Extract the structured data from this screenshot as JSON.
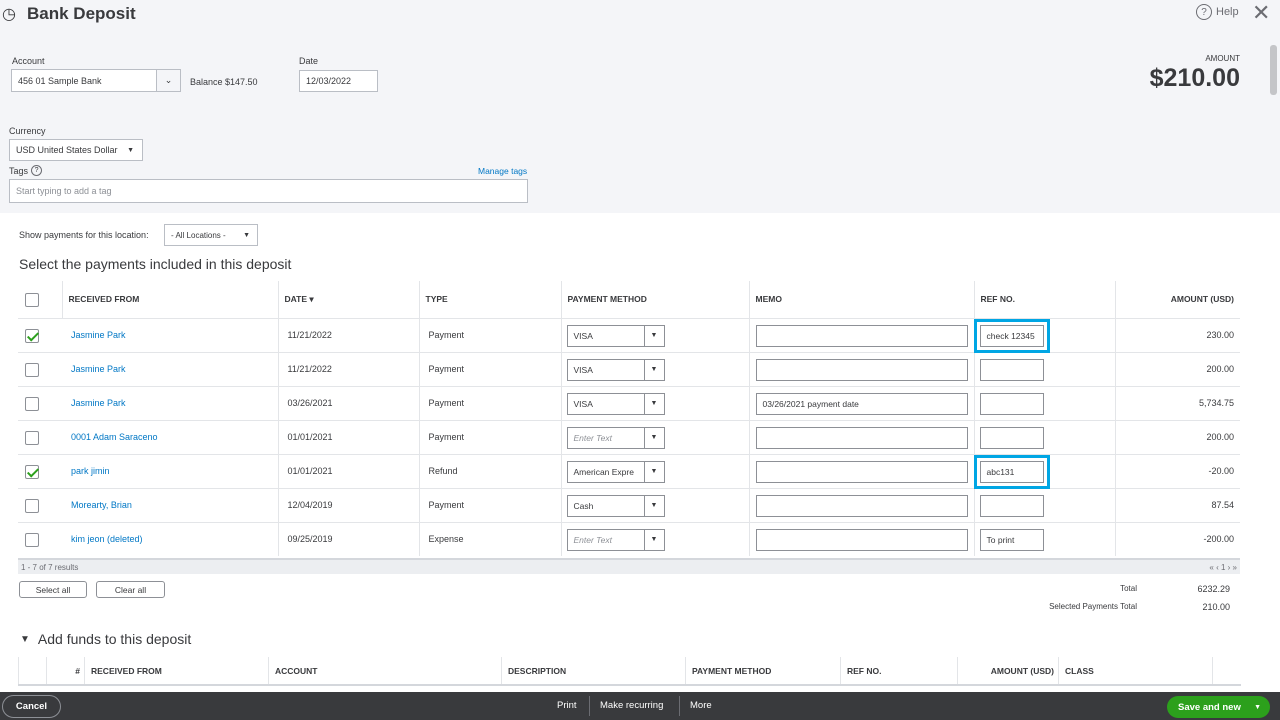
{
  "header": {
    "title": "Bank Deposit",
    "help": "Help",
    "amount_label": "AMOUNT",
    "amount": "$210.00"
  },
  "form": {
    "account_label": "Account",
    "account": "456 01 Sample Bank",
    "balance": "Balance $147.50",
    "date_label": "Date",
    "date": "12/03/2022",
    "currency_label": "Currency",
    "currency": "USD United States Dollar",
    "tags_label": "Tags",
    "manage_tags": "Manage tags",
    "tags_placeholder": "Start typing to add a tag"
  },
  "payments": {
    "location_label": "Show payments for this location:",
    "location": "- All Locations -",
    "heading": "Select the payments included in this deposit",
    "columns": [
      "RECEIVED FROM",
      "DATE ▾",
      "TYPE",
      "PAYMENT METHOD",
      "MEMO",
      "REF NO.",
      "AMOUNT (USD)"
    ],
    "rows": [
      {
        "checked": true,
        "from": "Jasmine Park",
        "date": "11/21/2022",
        "type": "Payment",
        "method": "VISA",
        "memo": "",
        "ref": "check 12345",
        "amount": "230.00",
        "hl": true
      },
      {
        "checked": false,
        "from": "Jasmine Park",
        "date": "11/21/2022",
        "type": "Payment",
        "method": "VISA",
        "memo": "",
        "ref": "",
        "amount": "200.00"
      },
      {
        "checked": false,
        "from": "Jasmine Park",
        "date": "03/26/2021",
        "type": "Payment",
        "method": "VISA",
        "memo": "03/26/2021 payment date",
        "ref": "",
        "amount": "5,734.75"
      },
      {
        "checked": false,
        "from": "0001 Adam Saraceno",
        "date": "01/01/2021",
        "type": "Payment",
        "method": "",
        "memo": "",
        "ref": "",
        "amount": "200.00"
      },
      {
        "checked": true,
        "from": "park jimin",
        "date": "01/01/2021",
        "type": "Refund",
        "method": "American Expre",
        "memo": "",
        "ref": "abc131",
        "amount": "-20.00",
        "hl": true
      },
      {
        "checked": false,
        "from": "Morearty, Brian",
        "date": "12/04/2019",
        "type": "Payment",
        "method": "Cash",
        "memo": "",
        "ref": "",
        "amount": "87.54"
      },
      {
        "checked": false,
        "from": "kim jeon (deleted)",
        "date": "09/25/2019",
        "type": "Expense",
        "method": "",
        "memo": "",
        "ref": "To print",
        "amount": "-200.00"
      }
    ],
    "method_placeholder": "Enter Text",
    "results": "1 - 7 of 7 results",
    "pager": "« ‹ 1 › »",
    "select_all": "Select all",
    "clear_all": "Clear all",
    "total_label": "Total",
    "total": "6232.29",
    "selected_label": "Selected Payments Total",
    "selected": "210.00"
  },
  "funds": {
    "heading": "Add funds to this deposit",
    "columns": [
      "#",
      "RECEIVED FROM",
      "ACCOUNT",
      "DESCRIPTION",
      "PAYMENT METHOD",
      "REF NO.",
      "AMOUNT (USD)",
      "CLASS"
    ]
  },
  "footer": {
    "cancel": "Cancel",
    "print": "Print",
    "recurring": "Make recurring",
    "more": "More",
    "save": "Save and new"
  }
}
